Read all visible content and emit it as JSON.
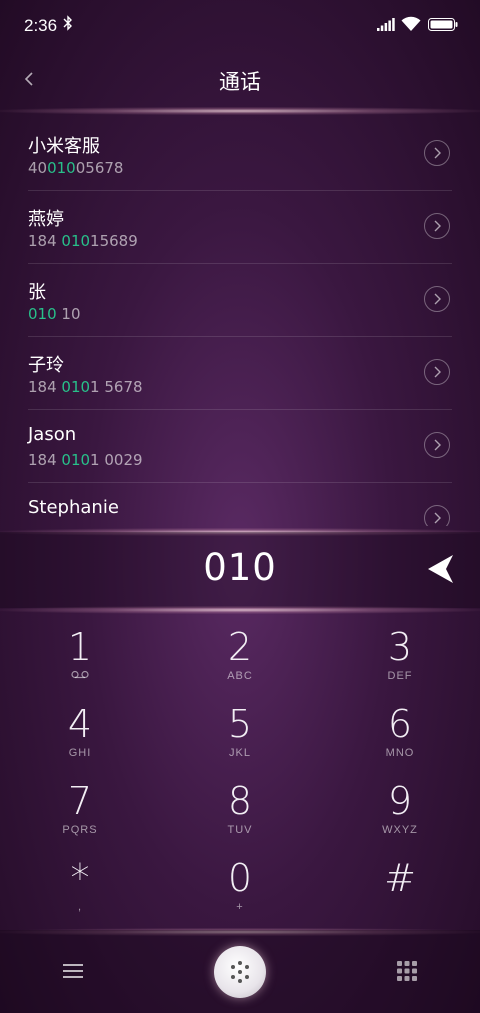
{
  "status_bar": {
    "time": "2:36"
  },
  "header": {
    "title": "通话"
  },
  "contacts": [
    {
      "name": "小米客服",
      "number_parts": [
        "40",
        "010",
        "05678"
      ]
    },
    {
      "name": "燕婷",
      "number_parts": [
        "184 ",
        "010",
        "15689"
      ]
    },
    {
      "name": "张",
      "number_parts": [
        "",
        "010",
        " 10"
      ]
    },
    {
      "name": "子玲",
      "number_parts": [
        "184 ",
        "010",
        "1 5678"
      ]
    },
    {
      "name": "Jason",
      "number_parts": [
        "184 ",
        "010",
        "1 0029"
      ]
    },
    {
      "name": "Stephanie",
      "number_parts": [
        "",
        "",
        ""
      ]
    }
  ],
  "dial": {
    "number": "010"
  },
  "keypad": [
    {
      "digit": "1",
      "sub": ""
    },
    {
      "digit": "2",
      "sub": "ABC"
    },
    {
      "digit": "3",
      "sub": "DEF"
    },
    {
      "digit": "4",
      "sub": "GHI"
    },
    {
      "digit": "5",
      "sub": "JKL"
    },
    {
      "digit": "6",
      "sub": "MNO"
    },
    {
      "digit": "7",
      "sub": "PQRS"
    },
    {
      "digit": "8",
      "sub": "TUV"
    },
    {
      "digit": "9",
      "sub": "WXYZ"
    },
    {
      "digit": "*",
      "sub": ","
    },
    {
      "digit": "0",
      "sub": "+"
    },
    {
      "digit": "#",
      "sub": ""
    }
  ],
  "icons": {
    "bluetooth": "bluetooth-icon",
    "signal": "signal-icon",
    "wifi": "wifi-icon",
    "battery": "battery-icon",
    "back": "chevron-left-icon",
    "detail": "chevron-right-circle-icon",
    "backspace": "backspace-arrow-icon",
    "voicemail": "voicemail-icon",
    "menu": "menu-icon",
    "dialpad": "dialpad-icon",
    "grid": "grid-icon"
  },
  "colors": {
    "highlight": "#28c08a",
    "background": "#3a1740"
  }
}
